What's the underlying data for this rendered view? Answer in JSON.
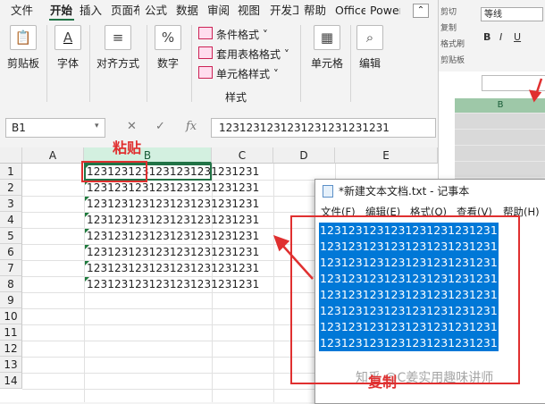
{
  "ribbon": {
    "tabs": [
      "文件",
      "开始",
      "插入",
      "页面布局",
      "公式",
      "数据",
      "审阅",
      "视图",
      "开发工具",
      "帮助",
      "Office",
      "Power"
    ],
    "active_tab": "开始",
    "groups": {
      "clipboard": "剪贴板",
      "font": "字体",
      "alignment": "对齐方式",
      "number": "数字",
      "cells": "单元格",
      "editing": "编辑"
    },
    "styles_items": [
      "条件格式 ˅",
      "套用表格格式 ˅",
      "单元格样式 ˅"
    ],
    "styles_label": "样式"
  },
  "right_window": {
    "font_name": "等线",
    "labels": [
      "剪切",
      "复制",
      "格式刷",
      "剪贴板"
    ],
    "format_buttons": [
      "B",
      "I",
      "U"
    ],
    "column": "B"
  },
  "formula_bar": {
    "name_box": "B1",
    "fx": "fx",
    "cancel": "✕",
    "enter": "✓",
    "content": "1231231231231231231231231"
  },
  "sheet": {
    "columns": [
      "A",
      "B",
      "C",
      "D",
      "E"
    ],
    "rows": [
      "1",
      "2",
      "3",
      "4",
      "5",
      "6",
      "7",
      "8",
      "9",
      "10",
      "11",
      "12",
      "13",
      "14"
    ],
    "cells": [
      "1231231231231231231231231",
      "1231231231231231231231231",
      "1231231231231231231231231",
      "1231231231231231231231231",
      "1231231231231231231231231",
      "1231231231231231231231231",
      "1231231231231231231231231",
      "1231231231231231231231231"
    ]
  },
  "notepad": {
    "title": "*新建文本文档.txt - 记事本",
    "menu": [
      "文件(F)",
      "编辑(E)",
      "格式(O)",
      "查看(V)",
      "帮助(H)"
    ],
    "lines": [
      "1231231231231231231231231",
      "1231231231231231231231231",
      "1231231231231231231231231",
      "1231231231231231231231231",
      "1231231231231231231231231",
      "1231231231231231231231231",
      "1231231231231231231231231",
      "1231231231231231231231231"
    ]
  },
  "annotations": {
    "paste": "粘贴",
    "copy": "复制",
    "watermark": "知乎 @C姜实用趣味讲师"
  },
  "colors": {
    "excel_green": "#217346",
    "selection_blue": "#0078d7",
    "annotation_red": "#e03030"
  }
}
